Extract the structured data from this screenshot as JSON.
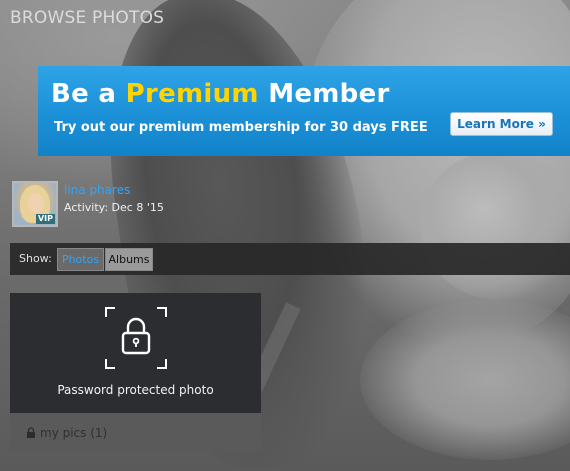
{
  "page": {
    "title": "BROWSE PHOTOS"
  },
  "banner": {
    "title_prefix": "Be a",
    "title_highlight": "Premium",
    "title_suffix": "Member",
    "subtitle": "Try out our premium membership for 30 days FREE",
    "cta_label": "Learn More »",
    "colors": {
      "background": "#1b8fd6",
      "highlight": "#ffd400",
      "text": "#ffffff"
    }
  },
  "user": {
    "name": "lina phares",
    "activity": "Activity: Dec 8 '15",
    "badge": "VIP",
    "link_color": "#2aa7ff"
  },
  "filter": {
    "label": "Show:",
    "options": [
      "Photos",
      "Albums"
    ],
    "selected": "Photos"
  },
  "album_card": {
    "icon": "lock-icon",
    "caption": "Password protected photo",
    "album_label": "my pics (1)"
  }
}
